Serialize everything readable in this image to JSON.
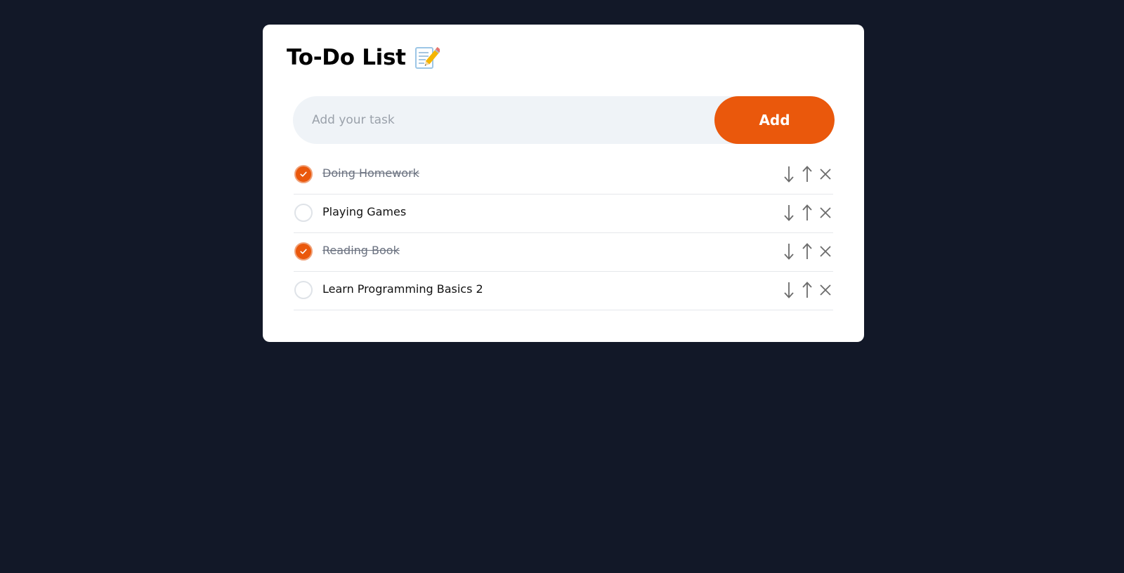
{
  "app": {
    "title": "To-Do List",
    "title_icon": "memo-pencil-icon"
  },
  "input": {
    "value": "",
    "placeholder": "Add your task"
  },
  "add_button": {
    "label": "Add"
  },
  "colors": {
    "background": "#121828",
    "card": "#ffffff",
    "accent": "#ea580c",
    "input_bg": "#eff3f7",
    "done_text": "#6b7280",
    "icon": "#6b6b6b"
  },
  "tasks": [
    {
      "text": "Doing Homework",
      "done": true
    },
    {
      "text": "Playing Games",
      "done": false
    },
    {
      "text": "Reading Book",
      "done": true
    },
    {
      "text": "Learn Programming Basics 2",
      "done": false
    }
  ],
  "task_actions": {
    "move_down_icon": "arrow-down-icon",
    "move_up_icon": "arrow-up-icon",
    "delete_icon": "close-icon"
  }
}
